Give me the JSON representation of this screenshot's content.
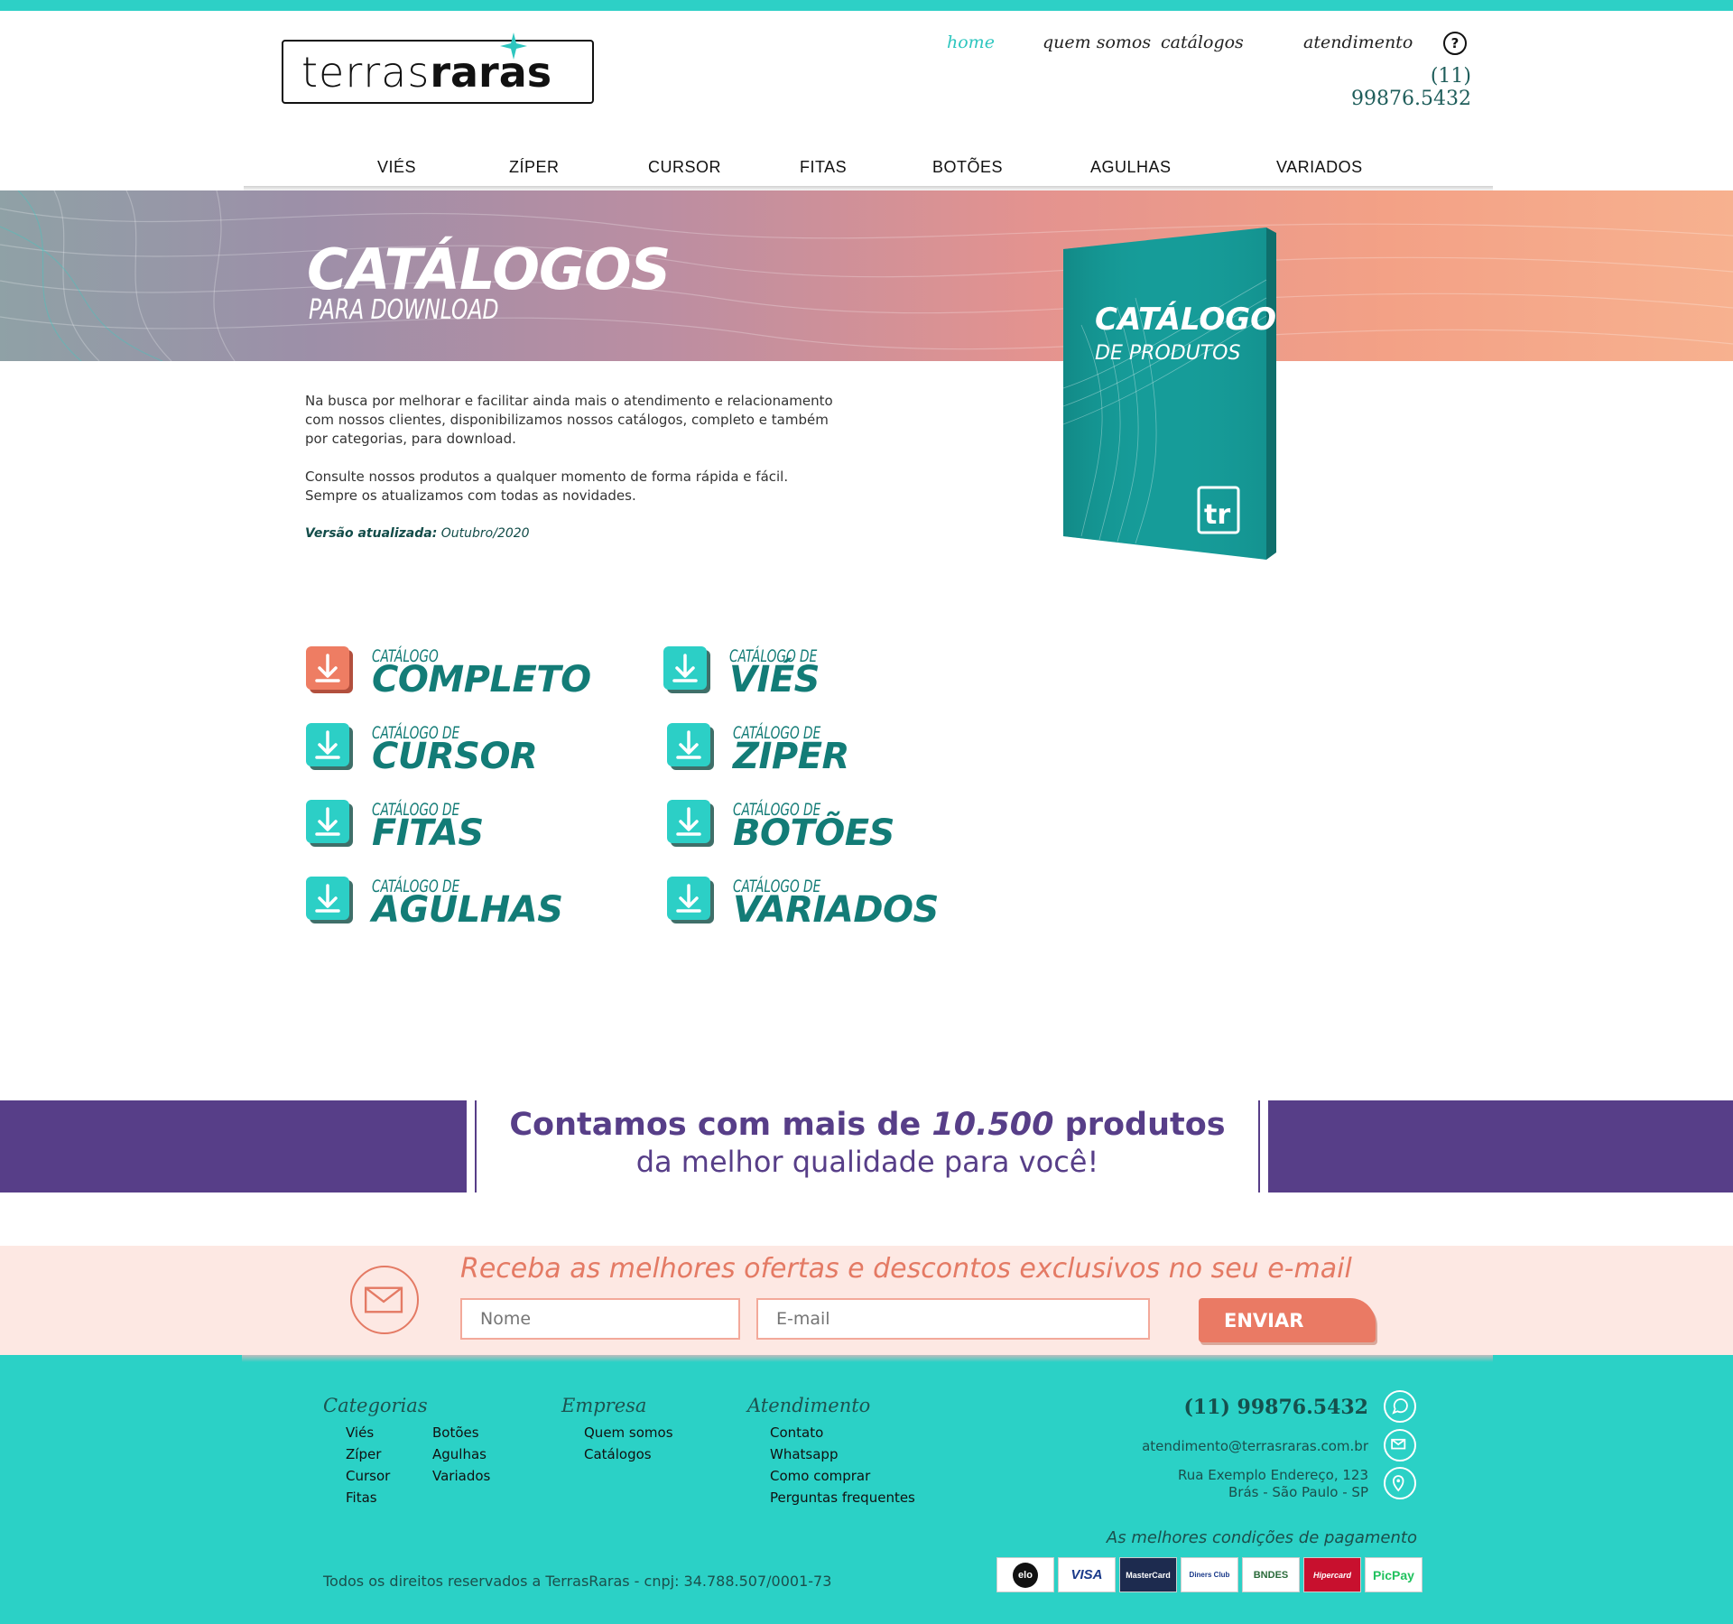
{
  "header": {
    "logo_light": "terras",
    "logo_bold": "raras",
    "nav": [
      "home",
      "quem somos",
      "catálogos",
      "atendimento"
    ],
    "help_icon_label": "?",
    "phone": "(11) 99876.5432"
  },
  "categories_nav": [
    "VIÉS",
    "ZÍPER",
    "CURSOR",
    "FITAS",
    "BOTÕES",
    "AGULHAS",
    "VARIADOS"
  ],
  "hero": {
    "title": "CATÁLOGOS",
    "subtitle": "PARA DOWNLOAD",
    "book_title": "CATÁLOGO",
    "book_subtitle": "DE PRODUTOS",
    "book_logo": "tr"
  },
  "intro": {
    "p1_lines": [
      "Na busca por melhorar e facilitar ainda mais o atendimento e relacionamento",
      "com nossos clientes, disponibilizamos nossos catálogos, completo e também",
      "por categorias, para download."
    ],
    "p2_lines": [
      "Consulte nossos produtos a qualquer momento de forma rápida e fácil.",
      "Sempre os atualizamos com todas as novidades."
    ],
    "version_label": "Versão atualizada:",
    "version_value": "Outubro/2020"
  },
  "catalogs": [
    {
      "small": "CATÁLOGO",
      "big": "COMPLETO",
      "color": "#ee7d63"
    },
    {
      "small": "CATÁLOGO DE",
      "big": "VIÉS",
      "color": "#2ccfc6"
    },
    {
      "small": "CATÁLOGO DE",
      "big": "CURSOR",
      "color": "#2ccfc6"
    },
    {
      "small": "CATÁLOGO DE",
      "big": "ZIPER",
      "color": "#2ccfc6"
    },
    {
      "small": "CATÁLOGO DE",
      "big": "FITAS",
      "color": "#2ccfc6"
    },
    {
      "small": "CATÁLOGO DE",
      "big": "BOTÕES",
      "color": "#2ccfc6"
    },
    {
      "small": "CATÁLOGO DE",
      "big": "AGULHAS",
      "color": "#2ccfc6"
    },
    {
      "small": "CATÁLOGO DE",
      "big": "VARIADOS",
      "color": "#2ccfc6"
    }
  ],
  "banner": {
    "line1_prefix": "Contamos com mais de",
    "line1_number": "10.500",
    "line1_suffix": "produtos",
    "line2": "da melhor qualidade para você!",
    "color": "#573e88"
  },
  "newsletter": {
    "title": "Receba as melhores ofertas e descontos exclusivos no seu e-mail",
    "name_placeholder": "Nome",
    "email_placeholder": "E-mail",
    "button": "ENVIAR"
  },
  "footer": {
    "categorias_title": "Categorias",
    "categorias_col1": [
      "Viés",
      "Zíper",
      "Cursor",
      "Fitas"
    ],
    "categorias_col2": [
      "Botões",
      "Agulhas",
      "Variados"
    ],
    "empresa_title": "Empresa",
    "empresa_links": [
      "Quem somos",
      "Catálogos"
    ],
    "atendimento_title": "Atendimento",
    "atendimento_links": [
      "Contato",
      "Whatsapp",
      "Como comprar",
      "Perguntas frequentes"
    ],
    "phone": "(11) 99876.5432",
    "email": "atendimento@terrasraras.com.br",
    "address_line1": "Rua Exemplo Endereço, 123",
    "address_line2": "Brás - São Paulo - SP",
    "payment_title": "As melhores condições de pagamento",
    "payment_methods": [
      "elo",
      "VISA",
      "MasterCard",
      "Diners Club",
      "BNDES",
      "Hipercard",
      "PicPay"
    ],
    "copyright": "Todos os direitos reservados a TerrasRaras - cnpj: 34.788.507/0001-73",
    "accent": "#2bd1c6"
  }
}
